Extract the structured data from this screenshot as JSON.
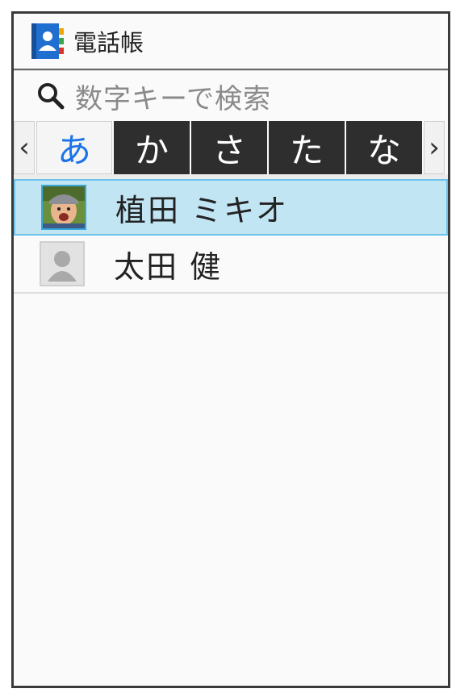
{
  "app": {
    "title": "電話帳"
  },
  "search": {
    "placeholder": "数字キーで検索"
  },
  "index_tabs": {
    "prev_arrow": "‹",
    "next_arrow": "›",
    "items": [
      "あ",
      "か",
      "さ",
      "た",
      "な"
    ],
    "active": "あ"
  },
  "contacts": [
    {
      "name": "植田 ミキオ",
      "selected": true,
      "avatar": "photo"
    },
    {
      "name": "太田 健",
      "selected": false,
      "avatar": "placeholder-person-icon"
    }
  ],
  "colors": {
    "accent_text": "#1a73e8",
    "selection_bg": "#c2e5f4",
    "selection_border": "#6cc2ea",
    "tab_bg": "#2e2e2e"
  }
}
